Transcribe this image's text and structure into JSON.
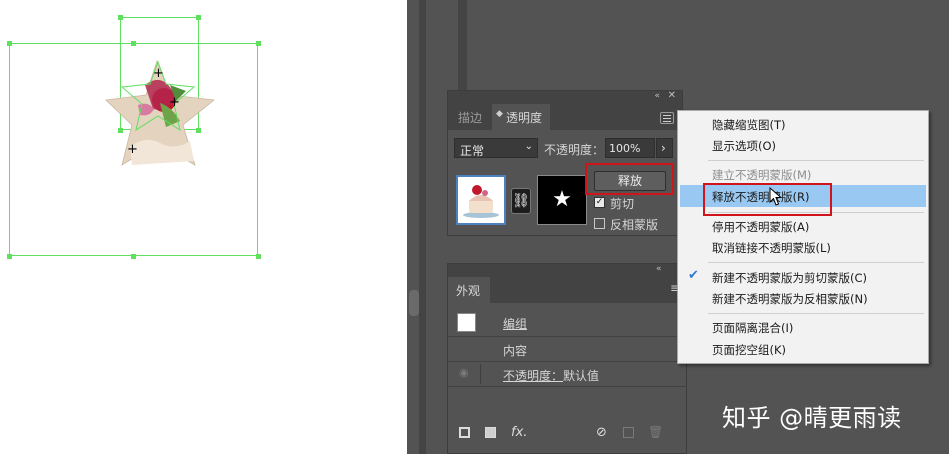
{
  "transparency_panel": {
    "tab_stroke": "描边",
    "tab_transparency": "透明度",
    "blend_mode": "正常",
    "opacity_label": "不透明度：",
    "opacity_value": "100%",
    "release_button": "释放",
    "clip_label": "剪切",
    "clip_checked": true,
    "invert_mask_label": "反相蒙版",
    "invert_checked": false
  },
  "appearance_panel": {
    "tab": "外观",
    "rows": [
      {
        "label": "编组"
      },
      {
        "label": "内容"
      },
      {
        "label": "不透明度：",
        "value": "默认值"
      }
    ],
    "fx_label": "fx."
  },
  "context_menu": {
    "items": [
      {
        "label": "隐藏缩览图(T)",
        "disabled": false
      },
      {
        "label": "显示选项(O)",
        "disabled": false
      },
      {
        "label": "建立不透明蒙版(M)",
        "disabled": true
      },
      {
        "label": "释放不透明蒙版(R)",
        "disabled": false,
        "highlighted": true
      },
      {
        "label": "停用不透明蒙版(A)",
        "disabled": false
      },
      {
        "label": "取消链接不透明蒙版(L)",
        "disabled": false
      },
      {
        "label": "新建不透明蒙版为剪切蒙版(C)",
        "disabled": false,
        "checked": true
      },
      {
        "label": "新建不透明蒙版为反相蒙版(N)",
        "disabled": false
      },
      {
        "label": "页面隔离混合(I)",
        "disabled": false
      },
      {
        "label": "页面挖空组(K)",
        "disabled": false
      }
    ]
  },
  "watermark": "知乎 @晴更雨读",
  "colors": {
    "selection": "#5fe05f",
    "panel_bg": "#535353",
    "highlight": "#99c9f2",
    "annotation_red": "#d0141a"
  }
}
